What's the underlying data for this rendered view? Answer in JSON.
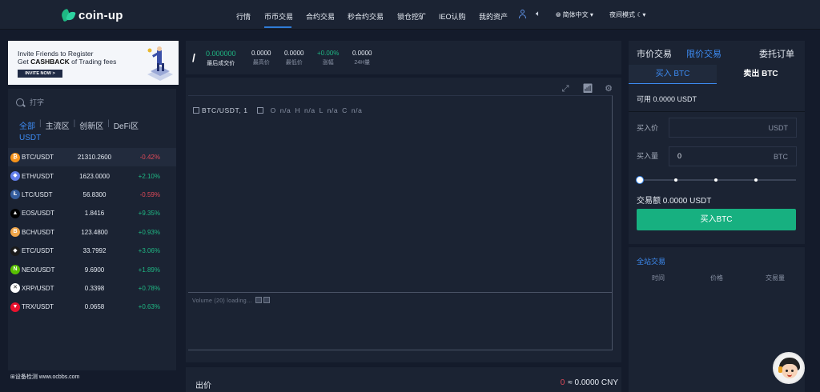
{
  "header": {
    "logo": "coin-up",
    "nav": [
      "行情",
      "币币交易",
      "合约交易",
      "秒合约交易",
      "锁仓挖矿",
      "IEO认购",
      "我的资产"
    ],
    "active_nav": "币币交易",
    "language": "简体中文",
    "night_mode": "夜间模式"
  },
  "banner": {
    "line1": "Invite Friends to Register",
    "line2_prefix": "Get",
    "line2_bold": "CASHBACK",
    "line2_suffix": "of Trading fees",
    "button": "INVITE NOW >"
  },
  "market": {
    "search_placeholder": "打字",
    "filters": [
      "全部",
      "主流区",
      "创新区",
      "DeFi区"
    ],
    "active_filter": "全部",
    "quote": "USDT",
    "rows": [
      {
        "pair": "BTC/USDT",
        "price": "21310.2600",
        "change": "-0.42%",
        "dir": "down",
        "icon": "bitcoin-icon",
        "color": "#f7931a",
        "glyph": "₿"
      },
      {
        "pair": "ETH/USDT",
        "price": "1623.0000",
        "change": "+2.10%",
        "dir": "up",
        "icon": "ethereum-icon",
        "color": "#627eea",
        "glyph": "◆"
      },
      {
        "pair": "LTC/USDT",
        "price": "56.8300",
        "change": "-0.59%",
        "dir": "down",
        "icon": "litecoin-icon",
        "color": "#345d9d",
        "glyph": "Ł"
      },
      {
        "pair": "EOS/USDT",
        "price": "1.8416",
        "change": "+9.35%",
        "dir": "up",
        "icon": "eos-icon",
        "color": "#000000",
        "glyph": "▲"
      },
      {
        "pair": "BCH/USDT",
        "price": "123.4800",
        "change": "+0.93%",
        "dir": "up",
        "icon": "bitcoin-cash-icon",
        "color": "#f0a64a",
        "glyph": "B"
      },
      {
        "pair": "ETC/USDT",
        "price": "33.7992",
        "change": "+3.06%",
        "dir": "up",
        "icon": "ethereum-classic-icon",
        "color": "#1b1b1b",
        "glyph": "◆"
      },
      {
        "pair": "NEO/USDT",
        "price": "9.6900",
        "change": "+1.89%",
        "dir": "up",
        "icon": "neo-icon",
        "color": "#58bf00",
        "glyph": "N"
      },
      {
        "pair": "XRP/USDT",
        "price": "0.3398",
        "change": "+0.78%",
        "dir": "up",
        "icon": "xrp-icon",
        "color": "#ffffff",
        "glyph": "✕"
      },
      {
        "pair": "TRX/USDT",
        "price": "0.0658",
        "change": "+0.63%",
        "dir": "up",
        "icon": "tron-icon",
        "color": "#e8112d",
        "glyph": "▼"
      }
    ]
  },
  "ticker": {
    "symbol": "/",
    "last_price": "0.000000",
    "last_price_label": "最后成交价",
    "high": "0.0000",
    "high_label": "最高价",
    "low": "0.0000",
    "low_label": "最低价",
    "change": "+0.00%",
    "change_label": "涨幅",
    "volume": "0.0000",
    "volume_label": "24H量"
  },
  "chart": {
    "pair_label": "BTC/USDT, 1",
    "ohlc": "O n/a  H n/a  L n/a  C n/a",
    "volume_label": "Volume (20) loading..."
  },
  "orderbook": {
    "title": "出价",
    "price_zero": "0",
    "cny": "≈ 0.0000 CNY"
  },
  "trade": {
    "tab_market": "市价交易",
    "tab_limit": "限价交易",
    "tab_orders": "委托订单",
    "buy_tab": "买入 BTC",
    "sell_tab": "卖出 BTC",
    "available": "可用 0.0000 USDT",
    "price_label": "买入价",
    "price_unit": "USDT",
    "price_value": "",
    "qty_label": "买入量",
    "qty_value": "0",
    "qty_unit": "BTC",
    "amount": "交易额 0.0000 USDT",
    "buy_button": "买入BTC",
    "slider_percent": 0
  },
  "all_trades": {
    "title": "全站交易",
    "headers": [
      "时间",
      "价格",
      "交易量"
    ]
  },
  "footer": {
    "left_text": "⊞设备检测  www.ocbbs.com"
  },
  "colors": {
    "accent": "#3d8bf2",
    "up": "#1fb884",
    "down": "#e04a59",
    "buy_button": "#17b080"
  }
}
